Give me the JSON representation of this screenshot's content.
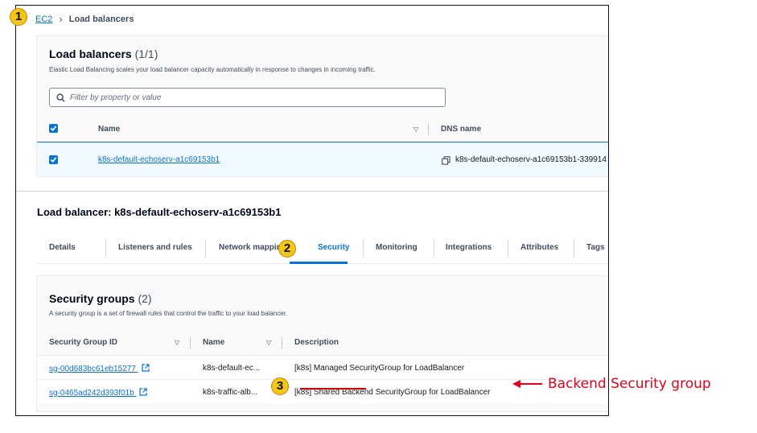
{
  "breadcrumb": {
    "root": "EC2",
    "separator": "›",
    "current": "Load balancers"
  },
  "load_balancers": {
    "title": "Load balancers",
    "count": "(1/1)",
    "description": "Elastic Load Balancing scales your load balancer capacity automatically in response to changes in incoming traffic.",
    "filter_placeholder": "Filter by property or value",
    "columns": {
      "name": "Name",
      "dns": "DNS name"
    },
    "rows": [
      {
        "name": "k8s-default-echoserv-a1c69153b1",
        "dns": "k8s-default-echoserv-a1c69153b1-339914"
      }
    ]
  },
  "detail": {
    "title": "Load balancer: k8s-default-echoserv-a1c69153b1",
    "tabs": [
      "Details",
      "Listeners and rules",
      "Network mapping",
      "Security",
      "Monitoring",
      "Integrations",
      "Attributes",
      "Tags"
    ],
    "active_tab": "Security"
  },
  "security_groups": {
    "title": "Security groups",
    "count": "(2)",
    "description": "A security group is a set of firewall rules that control the traffic to your load balancer.",
    "columns": {
      "id": "Security Group ID",
      "name": "Name",
      "description": "Description"
    },
    "rows": [
      {
        "id": "sg-00d683bc61eb15277",
        "name": "k8s-default-ec...",
        "description": "[k8s] Managed SecurityGroup for LoadBalancer"
      },
      {
        "id": "sg-0465ad242d393f01b",
        "name": "k8s-traffic-alb...",
        "desc_prefix": "[k8s] ",
        "desc_highlight": "Shared Backend",
        "desc_suffix": " SecurityGroup for LoadBalancer"
      }
    ]
  },
  "annotations": {
    "badge1": "1",
    "badge2": "2",
    "badge3": "3",
    "callout": "Backend Security group"
  },
  "colors": {
    "link": "#0972d3",
    "annotation": "#e3001b",
    "badge": "#f5c518"
  }
}
